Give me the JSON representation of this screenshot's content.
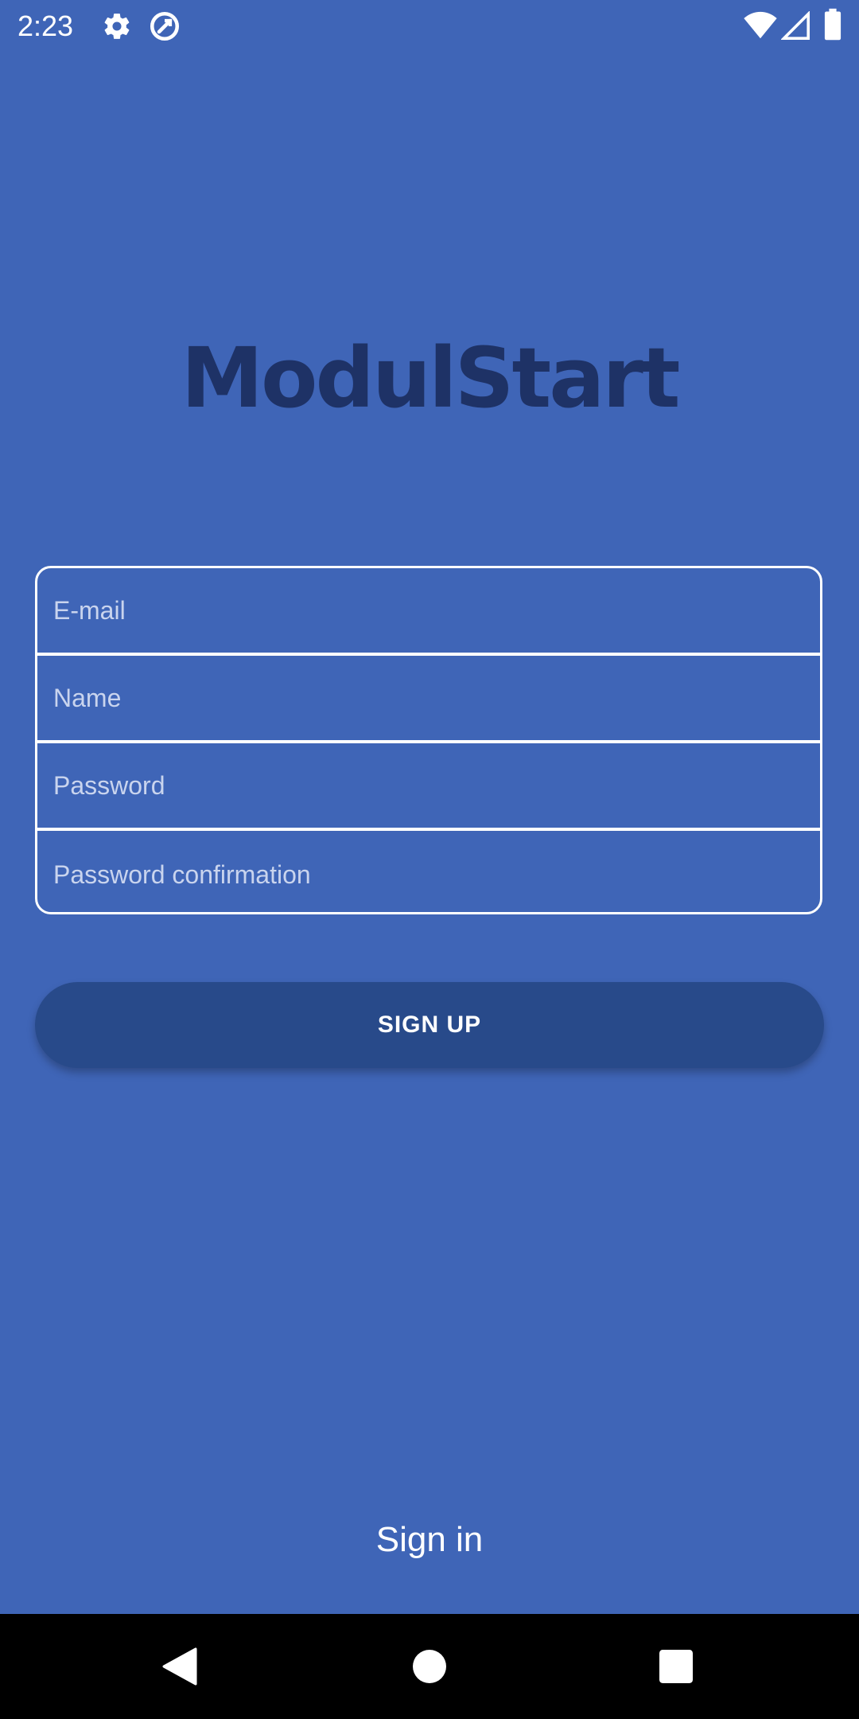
{
  "status_bar": {
    "time": "2:23",
    "icons": [
      "settings-icon",
      "sync-icon",
      "wifi-icon",
      "cell-signal-icon",
      "battery-icon"
    ]
  },
  "app": {
    "title": "ModulStart"
  },
  "form": {
    "email": {
      "placeholder": "E-mail",
      "value": ""
    },
    "name": {
      "placeholder": "Name",
      "value": ""
    },
    "password": {
      "placeholder": "Password",
      "value": ""
    },
    "password_confirmation": {
      "placeholder": "Password confirmation",
      "value": ""
    }
  },
  "actions": {
    "signup_label": "SIGN UP",
    "signin_label": "Sign in"
  },
  "nav_bar": {
    "buttons": [
      "back-icon",
      "home-icon",
      "recents-icon"
    ]
  },
  "colors": {
    "background": "#3f65b7",
    "title": "#1e3266",
    "button": "#284a8a",
    "nav_bar": "#000000"
  }
}
